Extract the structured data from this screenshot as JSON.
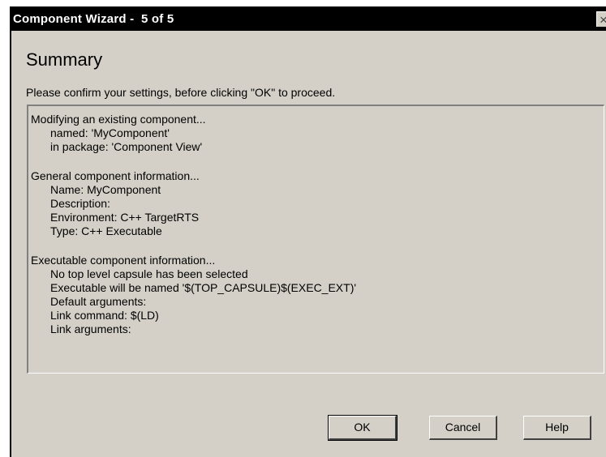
{
  "window": {
    "title": "Component Wizard -  5 of 5",
    "close_glyph": "×"
  },
  "page": {
    "heading": "Summary",
    "instructions": "Please confirm your settings, before clicking \"OK\" to proceed."
  },
  "summary": {
    "groups": [
      {
        "header": "Modifying an existing component...",
        "lines": [
          "named: 'MyComponent'",
          "in package: 'Component View'"
        ]
      },
      {
        "header": "General component information...",
        "lines": [
          "Name: MyComponent",
          "Description:",
          "Environment: C++ TargetRTS",
          "Type: C++ Executable"
        ]
      },
      {
        "header": "Executable component information...",
        "lines": [
          "No top level capsule has been selected",
          "Executable will be named '$(TOP_CAPSULE)$(EXEC_EXT)'",
          "Default arguments:",
          "Link command: $(LD)",
          "Link arguments:"
        ]
      }
    ]
  },
  "buttons": {
    "ok": "OK",
    "cancel": "Cancel",
    "help": "Help"
  }
}
